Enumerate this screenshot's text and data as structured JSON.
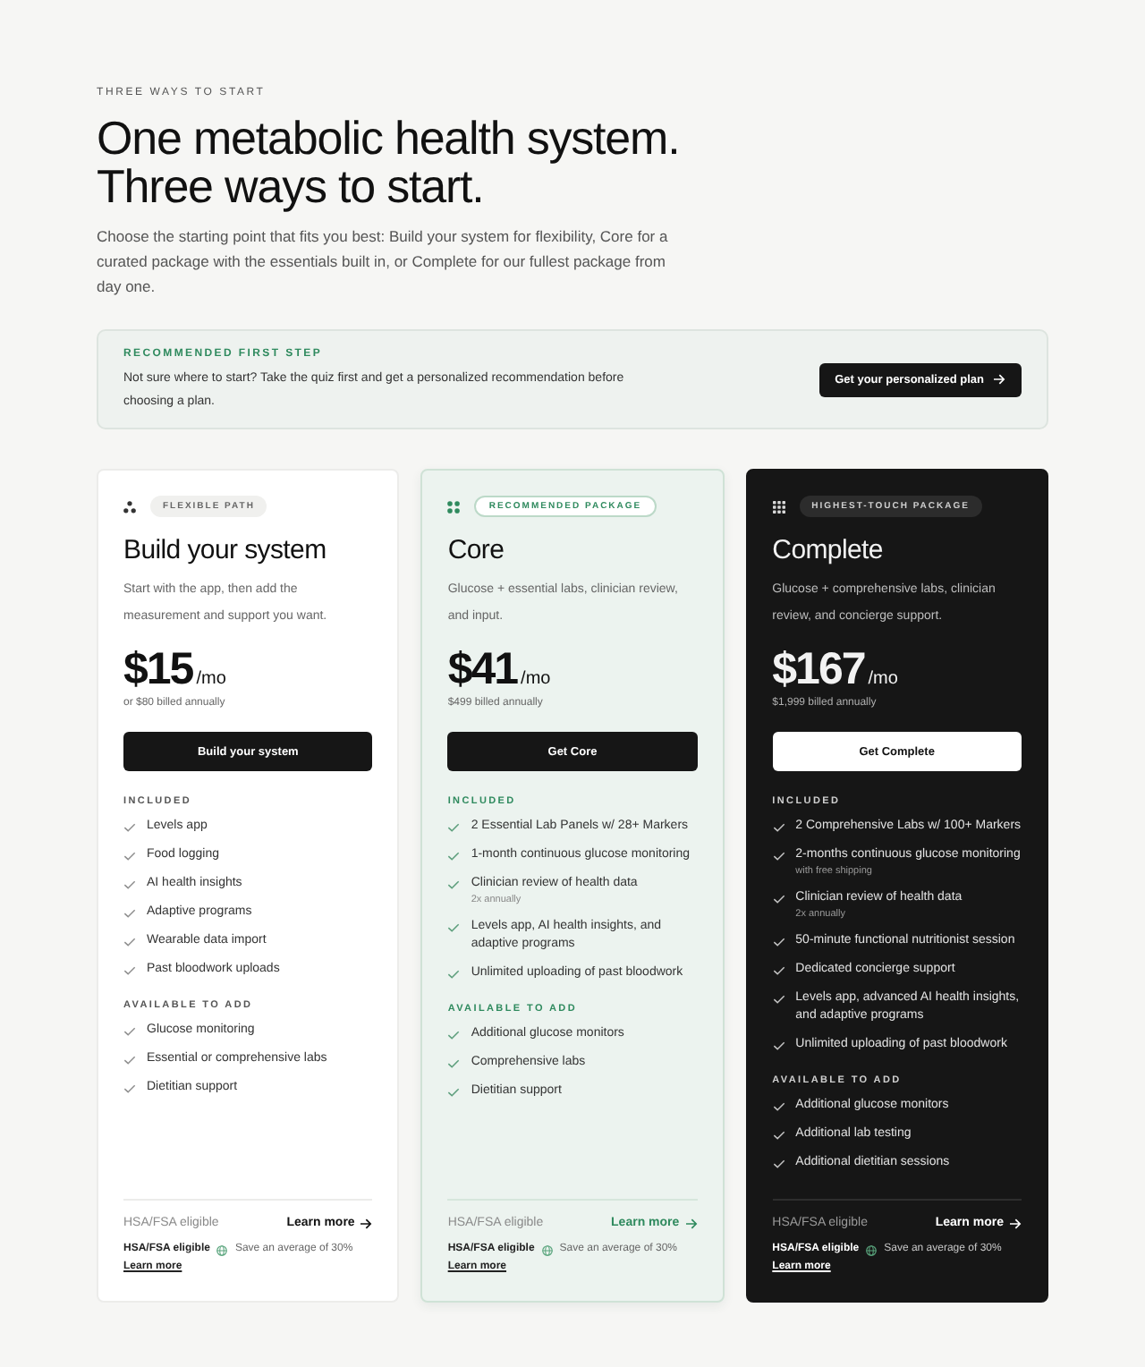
{
  "eyebrow": "THREE WAYS TO START",
  "headline": [
    "One metabolic health system.",
    "Three ways to start."
  ],
  "intro": "Choose the starting point that fits you best: Build your system for flexibility, Core for a curated package with the essentials built in, or Complete for our fullest package from day one.",
  "banner": {
    "label": "RECOMMENDED FIRST STEP",
    "text": "Not sure where to start? Take the quiz first and get a personalized recommendation before choosing a plan.",
    "button": "Get your personalized plan"
  },
  "plans": [
    {
      "kind": "flexible",
      "badge": "FLEXIBLE PATH",
      "name": "Build your system",
      "description": "Start with the app, then add the measurement and support you want.",
      "price": "$15",
      "period": "/mo",
      "billing": "or $80 billed annually",
      "button": "Build your system",
      "sections": [
        {
          "title": "INCLUDED",
          "items": [
            {
              "text": "Levels app"
            },
            {
              "text": "Food logging"
            },
            {
              "text": "AI health insights"
            },
            {
              "text": "Adaptive programs"
            },
            {
              "text": "Wearable data import"
            },
            {
              "text": "Past bloodwork uploads"
            }
          ]
        },
        {
          "title": "AVAILABLE TO ADD",
          "items": [
            {
              "text": "Glucose monitoring"
            },
            {
              "text": "Essential or comprehensive labs"
            },
            {
              "text": "Dietitian support"
            }
          ]
        }
      ],
      "footer": {
        "eligibility": "HSA/FSA eligible",
        "link": "Learn more",
        "tag": "HSA/FSA eligible",
        "savings": "Save an average of 30%",
        "tag_link": "Learn more"
      }
    },
    {
      "kind": "recommended",
      "badge": "RECOMMENDED PACKAGE",
      "name": "Core",
      "description": "Glucose + essential labs, clinician review, and input.",
      "price": "$41",
      "period": "/mo",
      "billing": "$499 billed annually",
      "button": "Get Core",
      "sections": [
        {
          "title": "INCLUDED",
          "items": [
            {
              "text": "2 Essential Lab Panels w/ 28+ Markers"
            },
            {
              "text": "1-month continuous glucose monitoring"
            },
            {
              "text": "Clinician review of health data",
              "note": "2x annually"
            },
            {
              "text": "Levels app, AI health insights, and adaptive programs"
            },
            {
              "text": "Unlimited uploading of past bloodwork"
            }
          ]
        },
        {
          "title": "AVAILABLE TO ADD",
          "items": [
            {
              "text": "Additional glucose monitors"
            },
            {
              "text": "Comprehensive labs"
            },
            {
              "text": "Dietitian support"
            }
          ]
        }
      ],
      "footer": {
        "eligibility": "HSA/FSA eligible",
        "link": "Learn more",
        "tag": "HSA/FSA eligible",
        "savings": "Save an average of 30%",
        "tag_link": "Learn more"
      }
    },
    {
      "kind": "premium",
      "badge": "HIGHEST-TOUCH PACKAGE",
      "name": "Complete",
      "description": "Glucose + comprehensive labs, clinician review, and concierge support.",
      "price": "$167",
      "period": "/mo",
      "billing": "$1,999 billed annually",
      "button": "Get Complete",
      "sections": [
        {
          "title": "INCLUDED",
          "items": [
            {
              "text": "2 Comprehensive Labs w/ 100+ Markers"
            },
            {
              "text": "2-months continuous glucose monitoring",
              "note": "with free shipping"
            },
            {
              "text": "Clinician review of health data",
              "note": "2x annually"
            },
            {
              "text": "50-minute functional nutritionist session"
            },
            {
              "text": "Dedicated concierge support"
            },
            {
              "text": "Levels app, advanced AI health insights, and adaptive programs"
            },
            {
              "text": "Unlimited uploading of past bloodwork"
            }
          ]
        },
        {
          "title": "AVAILABLE TO ADD",
          "items": [
            {
              "text": "Additional glucose monitors"
            },
            {
              "text": "Additional lab testing"
            },
            {
              "text": "Additional dietitian sessions"
            }
          ]
        }
      ],
      "footer": {
        "eligibility": "HSA/FSA eligible",
        "link": "Learn more",
        "tag": "HSA/FSA eligible",
        "savings": "Save an average of 30%",
        "tag_link": "Learn more"
      }
    }
  ]
}
